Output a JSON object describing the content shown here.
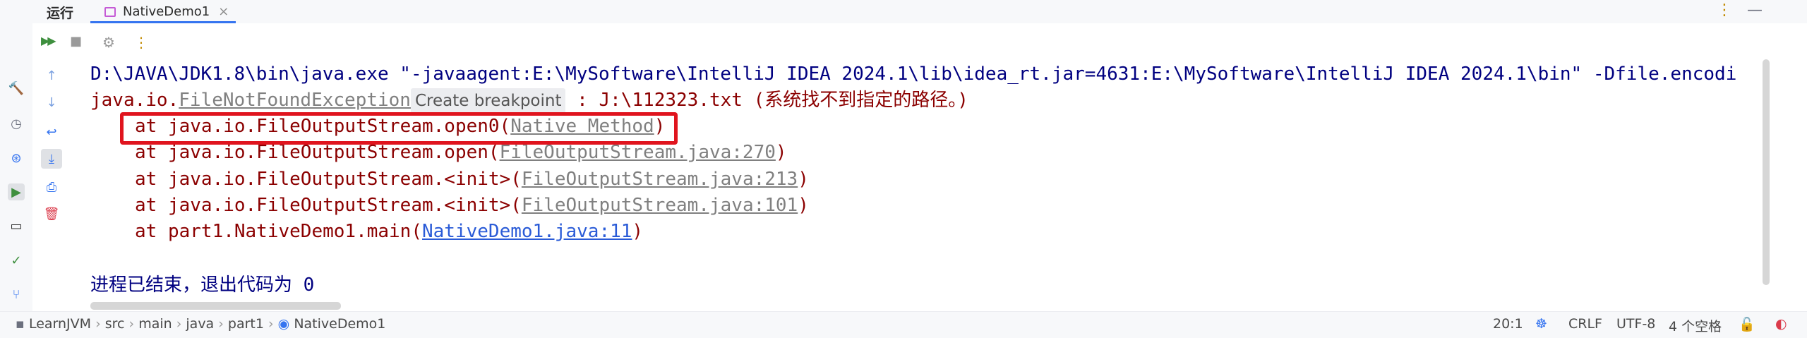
{
  "header": {
    "title": "运行",
    "tab_label": "NativeDemo1",
    "tab_close": "×",
    "more_icon": "⋮",
    "minimize_icon": "—"
  },
  "toolbar": {
    "rerun_icon": "▶▶",
    "stop_icon": "■",
    "settings_icon": "⚙",
    "more_icon": "⋮"
  },
  "console": {
    "command": "D:\\JAVA\\JDK1.8\\bin\\java.exe \"-javaagent:E:\\MySoftware\\IntelliJ IDEA 2024.1\\lib\\idea_rt.jar=4631:E:\\MySoftware\\IntelliJ IDEA 2024.1\\bin\" -Dfile.encodi",
    "exception_prefix": "java.io.",
    "exception_name": "FileNotFoundException",
    "tooltip": "Create breakpoint",
    "exception_suffix": " : J:\\112323.txt (系统找不到指定的路径。)",
    "stack": [
      {
        "prefix": "at java.io.FileOutputStream.open0(",
        "link": "Native Method",
        "suffix": ")"
      },
      {
        "prefix": "at java.io.FileOutputStream.open(",
        "link": "FileOutputStream.java:270",
        "suffix": ")"
      },
      {
        "prefix": "at java.io.FileOutputStream.<init>(",
        "link": "FileOutputStream.java:213",
        "suffix": ")"
      },
      {
        "prefix": "at java.io.FileOutputStream.<init>(",
        "link": "FileOutputStream.java:101",
        "suffix": ")"
      },
      {
        "prefix": "at part1.NativeDemo1.main(",
        "link": "NativeDemo1.java:11",
        "suffix": ")"
      }
    ],
    "exit_message": "进程已结束，退出代码为 0"
  },
  "breadcrumb": {
    "items": [
      "LearnJVM",
      "src",
      "main",
      "java",
      "part1",
      "NativeDemo1"
    ],
    "separator": "›"
  },
  "status": {
    "position": "20:1",
    "line_ending": "CRLF",
    "encoding": "UTF-8",
    "indent": "4 个空格"
  },
  "colors": {
    "error_text": "#8b0000",
    "command_text": "#000080",
    "highlight_border": "#e0141e",
    "accent": "#3574f0"
  }
}
